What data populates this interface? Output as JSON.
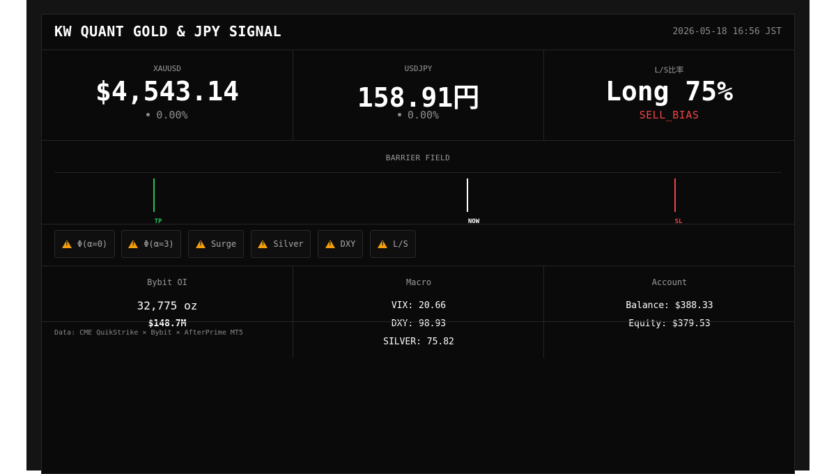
{
  "header": {
    "title": "KW QUANT GOLD & JPY SIGNAL",
    "timestamp": "2026-05-18 16:56 JST"
  },
  "quotes": [
    {
      "label": "XAUUSD",
      "value": "$4,543.14",
      "change": "0.00%"
    },
    {
      "label": "USDJPY",
      "value": "158.91円",
      "change": "0.00%"
    },
    {
      "label": "L/S比率",
      "value": "Long 75%",
      "bias": "SELL_BIAS"
    }
  ],
  "barrier": {
    "title": "BARRIER FIELD",
    "markers": [
      {
        "label": "TP",
        "color": "#22c55e"
      },
      {
        "label": "NOW",
        "color": "#ffffff"
      },
      {
        "label": "SL",
        "color": "#ef4444"
      }
    ]
  },
  "chips": [
    {
      "label": "Φ(α=0)",
      "icon": "warning-icon"
    },
    {
      "label": "Φ(α=3)",
      "icon": "warning-icon"
    },
    {
      "label": "Surge",
      "icon": "warning-icon"
    },
    {
      "label": "Silver",
      "icon": "warning-icon"
    },
    {
      "label": "DXY",
      "icon": "warning-icon"
    },
    {
      "label": "L/S",
      "icon": "warning-icon"
    }
  ],
  "stats": {
    "bybit": {
      "label": "Bybit OI",
      "oi": "32,775 oz",
      "notional": "$148.7M"
    },
    "macro": {
      "label": "Macro",
      "vix": "VIX: 20.66",
      "dxy": "DXY: 98.93",
      "silver": "SILVER: 75.82"
    },
    "account": {
      "label": "Account",
      "balance": "Balance: $388.33",
      "equity": "Equity: $379.53"
    }
  },
  "source": "Data: CME QuikStrike × Bybit × AfterPrime MT5",
  "colors": {
    "accent_green": "#22c55e",
    "accent_red": "#ef4444",
    "warning": "#f59e0b",
    "background": "#0a0a0a"
  }
}
